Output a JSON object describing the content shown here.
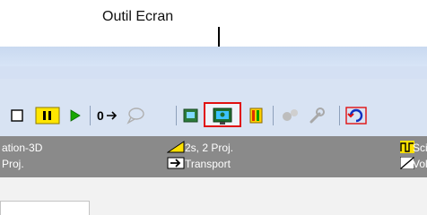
{
  "annotation": {
    "label": "Outil Ecran"
  },
  "toolbar": {
    "icons": [
      "square-icon",
      "pause-icon",
      "play-icon",
      "counter-arrow-icon",
      "speech-bubble-icon",
      "image-icon",
      "screen-tool-icon",
      "grid-icon",
      "molecule-icon",
      "wrench-icon",
      "cycle-icon"
    ],
    "counter_label": "0",
    "selected_tool": "screen-tool-icon"
  },
  "statusbar": {
    "col1_line1": "ation-3D",
    "col1_line2": "Proj.",
    "col2_line1": "2s, 2 Proj.",
    "col2_line2": "Transport",
    "col3_line1": "Sci",
    "col3_line2": "Vol"
  },
  "colors": {
    "highlight": "#e01010",
    "toolbar_bg": "#d8e3f3",
    "status_bg": "#8a8a8a"
  }
}
